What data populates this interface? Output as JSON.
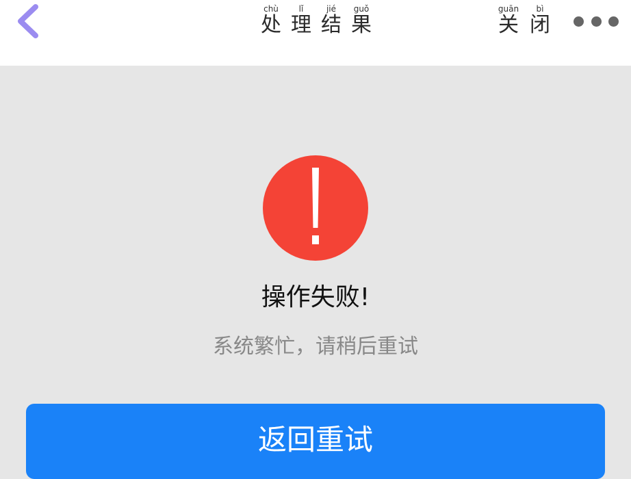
{
  "header": {
    "back_icon": "chevron-left-icon",
    "title": [
      {
        "pinyin": "chù",
        "char": "处"
      },
      {
        "pinyin": "lǐ",
        "char": "理"
      },
      {
        "pinyin": "jié",
        "char": "结"
      },
      {
        "pinyin": "guǒ",
        "char": "果"
      }
    ],
    "close": [
      {
        "pinyin": "guān",
        "char": "关"
      },
      {
        "pinyin": "bì",
        "char": "闭"
      }
    ],
    "more_icon": "more-dots-icon"
  },
  "result": {
    "icon": "error-exclamation-icon",
    "icon_color": "#f44336",
    "title": "操作失败!",
    "description": "系统繁忙，请稍后重试"
  },
  "actions": {
    "retry_label": "返回重试"
  },
  "colors": {
    "accent": "#1a82f8",
    "back_icon": "#9b8cf0",
    "background": "#e6e6e6"
  }
}
